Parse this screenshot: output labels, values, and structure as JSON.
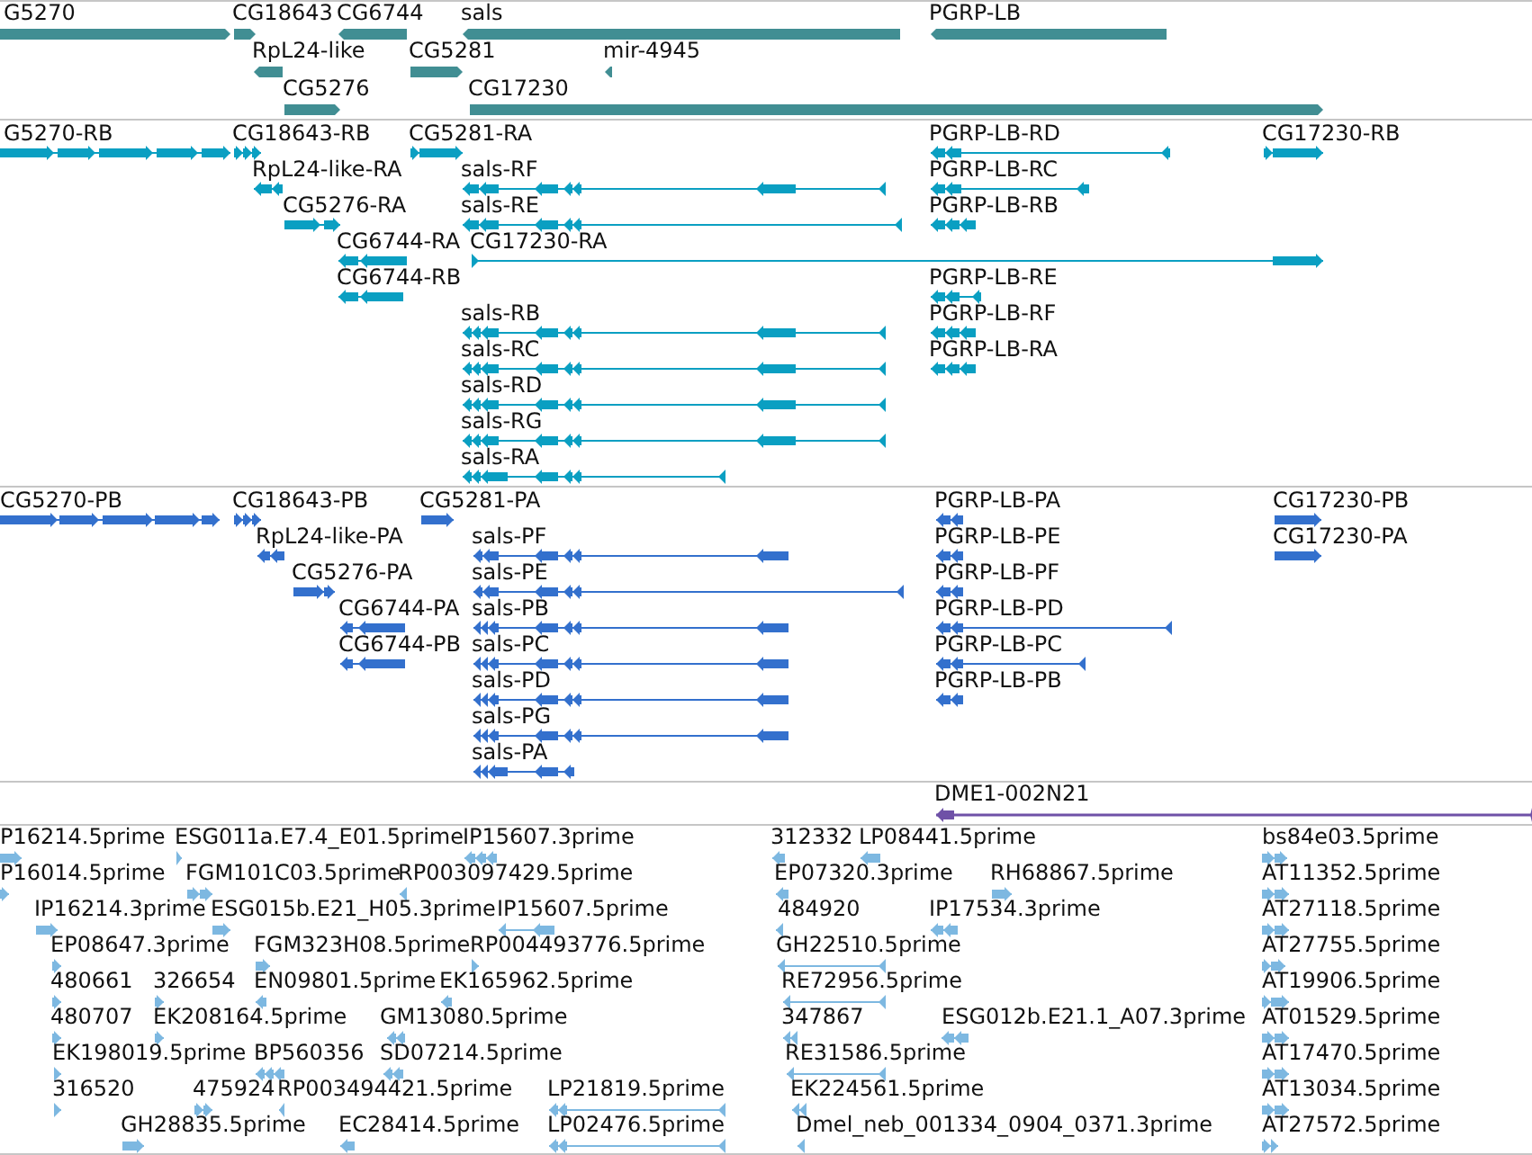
{
  "tracks": [
    {
      "kind": "gene",
      "features": [
        {
          "label": "G5270",
          "reverse": false
        },
        {
          "label": "CG18643",
          "reverse": false
        },
        {
          "label": "CG6744",
          "reverse": true
        },
        {
          "label": "sals",
          "reverse": true
        },
        {
          "label": "PGRP-LB",
          "reverse": true
        },
        {
          "label": "RpL24-like",
          "reverse": true
        },
        {
          "label": "CG5281",
          "reverse": false
        },
        {
          "label": "mir-4945",
          "reverse": true
        },
        {
          "label": "CG5276",
          "reverse": false
        },
        {
          "label": "CG17230",
          "reverse": false
        }
      ]
    },
    {
      "kind": "transcript",
      "features": [
        {
          "label": "G5270-RB",
          "reverse": false
        },
        {
          "label": "CG18643-RB",
          "reverse": false
        },
        {
          "label": "CG5281-RA",
          "reverse": false
        },
        {
          "label": "PGRP-LB-RD",
          "reverse": true
        },
        {
          "label": "CG17230-RB",
          "reverse": false
        },
        {
          "label": "RpL24-like-RA",
          "reverse": true
        },
        {
          "label": "sals-RF",
          "reverse": true
        },
        {
          "label": "PGRP-LB-RC",
          "reverse": true
        },
        {
          "label": "CG5276-RA",
          "reverse": false
        },
        {
          "label": "sals-RE",
          "reverse": true
        },
        {
          "label": "PGRP-LB-RB",
          "reverse": true
        },
        {
          "label": "CG6744-RA",
          "reverse": true
        },
        {
          "label": "CG17230-RA",
          "reverse": false
        },
        {
          "label": "CG6744-RB",
          "reverse": true
        },
        {
          "label": "PGRP-LB-RE",
          "reverse": true
        },
        {
          "label": "sals-RB",
          "reverse": true
        },
        {
          "label": "PGRP-LB-RF",
          "reverse": true
        },
        {
          "label": "sals-RC",
          "reverse": true
        },
        {
          "label": "PGRP-LB-RA",
          "reverse": true
        },
        {
          "label": "sals-RD",
          "reverse": true
        },
        {
          "label": "sals-RG",
          "reverse": true
        },
        {
          "label": "sals-RA",
          "reverse": true
        }
      ]
    },
    {
      "kind": "protein",
      "features": [
        {
          "label": "CG5270-PB",
          "reverse": false
        },
        {
          "label": "CG18643-PB",
          "reverse": false
        },
        {
          "label": "CG5281-PA",
          "reverse": false
        },
        {
          "label": "PGRP-LB-PA",
          "reverse": true
        },
        {
          "label": "CG17230-PB",
          "reverse": false
        },
        {
          "label": "RpL24-like-PA",
          "reverse": true
        },
        {
          "label": "sals-PF",
          "reverse": true
        },
        {
          "label": "PGRP-LB-PE",
          "reverse": true
        },
        {
          "label": "CG17230-PA",
          "reverse": false
        },
        {
          "label": "CG5276-PA",
          "reverse": false
        },
        {
          "label": "sals-PE",
          "reverse": true
        },
        {
          "label": "PGRP-LB-PF",
          "reverse": true
        },
        {
          "label": "CG6744-PA",
          "reverse": true
        },
        {
          "label": "sals-PB",
          "reverse": true
        },
        {
          "label": "PGRP-LB-PD",
          "reverse": true
        },
        {
          "label": "CG6744-PB",
          "reverse": true
        },
        {
          "label": "sals-PC",
          "reverse": true
        },
        {
          "label": "PGRP-LB-PC",
          "reverse": true
        },
        {
          "label": "sals-PD",
          "reverse": true
        },
        {
          "label": "PGRP-LB-PB",
          "reverse": true
        },
        {
          "label": "sals-PG",
          "reverse": true
        },
        {
          "label": "sals-PA",
          "reverse": true
        }
      ]
    },
    {
      "kind": "clone",
      "features": [
        {
          "label": "DME1-002N21",
          "reverse": true
        }
      ]
    },
    {
      "kind": "est",
      "features": [
        {
          "label": "P16214.5prime",
          "reverse": false
        },
        {
          "label": "ESG011a.E7.4_E01.5prime",
          "reverse": false
        },
        {
          "label": "IP15607.3prime",
          "reverse": true
        },
        {
          "label": "312332",
          "reverse": true
        },
        {
          "label": "LP08441.5prime",
          "reverse": true
        },
        {
          "label": "bs84e03.5prime",
          "reverse": false
        },
        {
          "label": "P16014.5prime",
          "reverse": false
        },
        {
          "label": "FGM101C03.5prime",
          "reverse": false
        },
        {
          "label": "RP003097429.5prime",
          "reverse": true
        },
        {
          "label": "EP07320.3prime",
          "reverse": true
        },
        {
          "label": "RH68867.5prime",
          "reverse": false
        },
        {
          "label": "AT11352.5prime",
          "reverse": false
        },
        {
          "label": "IP16214.3prime",
          "reverse": false
        },
        {
          "label": "ESG015b.E21_H05.3prime",
          "reverse": false
        },
        {
          "label": "IP15607.5prime",
          "reverse": true
        },
        {
          "label": "484920",
          "reverse": true
        },
        {
          "label": "IP17534.3prime",
          "reverse": true
        },
        {
          "label": "AT27118.5prime",
          "reverse": false
        },
        {
          "label": "EP08647.3prime",
          "reverse": false
        },
        {
          "label": "FGM323H08.5prime",
          "reverse": false
        },
        {
          "label": "RP004493776.5prime",
          "reverse": false
        },
        {
          "label": "GH22510.5prime",
          "reverse": true
        },
        {
          "label": "AT27755.5prime",
          "reverse": false
        },
        {
          "label": "480661",
          "reverse": false
        },
        {
          "label": "326654",
          "reverse": false
        },
        {
          "label": "EN09801.5prime",
          "reverse": true
        },
        {
          "label": "EK165962.5prime",
          "reverse": true
        },
        {
          "label": "RE72956.5prime",
          "reverse": true
        },
        {
          "label": "AT19906.5prime",
          "reverse": false
        },
        {
          "label": "480707",
          "reverse": false
        },
        {
          "label": "EK208164.5prime",
          "reverse": false
        },
        {
          "label": "GM13080.5prime",
          "reverse": true
        },
        {
          "label": "347867",
          "reverse": true
        },
        {
          "label": "ESG012b.E21.1_A07.3prime",
          "reverse": true
        },
        {
          "label": "AT01529.5prime",
          "reverse": false
        },
        {
          "label": "EK198019.5prime",
          "reverse": false
        },
        {
          "label": "BP560356",
          "reverse": true
        },
        {
          "label": "SD07214.5prime",
          "reverse": true
        },
        {
          "label": "RE31586.5prime",
          "reverse": true
        },
        {
          "label": "AT17470.5prime",
          "reverse": false
        },
        {
          "label": "316520",
          "reverse": false
        },
        {
          "label": "475924",
          "reverse": false
        },
        {
          "label": "RP003494421.5prime",
          "reverse": true
        },
        {
          "label": "LP21819.5prime",
          "reverse": true
        },
        {
          "label": "EK224561.5prime",
          "reverse": true
        },
        {
          "label": "AT13034.5prime",
          "reverse": false
        },
        {
          "label": "GH28835.5prime",
          "reverse": false
        },
        {
          "label": "EC28414.5prime",
          "reverse": true
        },
        {
          "label": "LP02476.5prime",
          "reverse": true
        },
        {
          "label": "Dmel_neb_001334_0904_0371.3prime",
          "reverse": true
        },
        {
          "label": "AT27572.5prime",
          "reverse": false
        }
      ]
    }
  ]
}
